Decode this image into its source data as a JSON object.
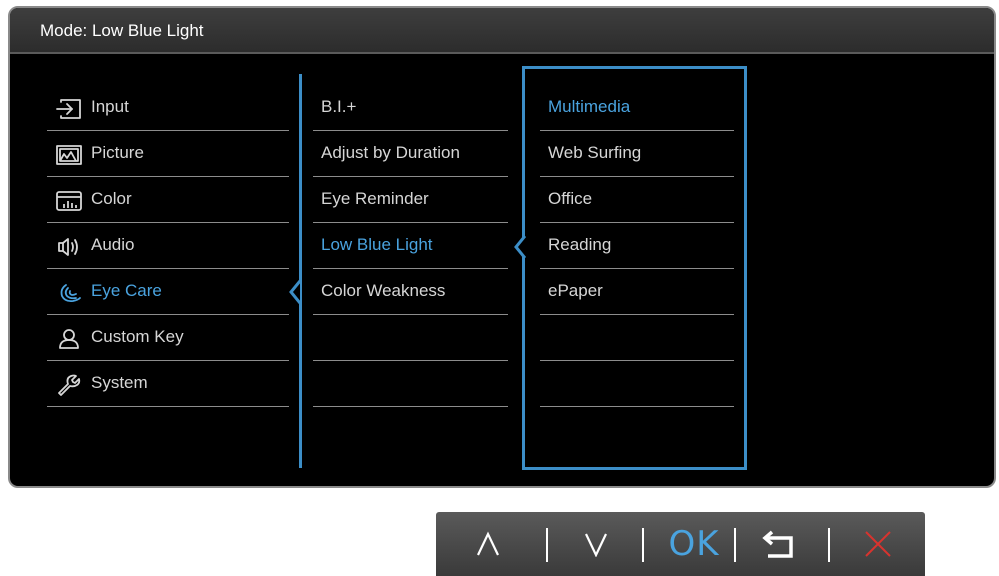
{
  "header": {
    "title": "Mode: Low Blue Light"
  },
  "menu": {
    "items": [
      {
        "label": "Input",
        "icon": "input-icon",
        "active": false
      },
      {
        "label": "Picture",
        "icon": "picture-icon",
        "active": false
      },
      {
        "label": "Color",
        "icon": "color-icon",
        "active": false
      },
      {
        "label": "Audio",
        "icon": "audio-icon",
        "active": false
      },
      {
        "label": "Eye Care",
        "icon": "eye-care-icon",
        "active": true
      },
      {
        "label": "Custom Key",
        "icon": "custom-key-icon",
        "active": false
      },
      {
        "label": "System",
        "icon": "system-icon",
        "active": false
      }
    ]
  },
  "submenu": {
    "items": [
      {
        "label": "B.I.+"
      },
      {
        "label": "Adjust by Duration"
      },
      {
        "label": "Eye Reminder"
      },
      {
        "label": "Low Blue Light",
        "active": true
      },
      {
        "label": "Color Weakness"
      },
      {
        "label": ""
      },
      {
        "label": ""
      }
    ]
  },
  "options": {
    "items": [
      {
        "label": "Multimedia",
        "active": true
      },
      {
        "label": "Web Surfing"
      },
      {
        "label": "Office"
      },
      {
        "label": "Reading"
      },
      {
        "label": "ePaper"
      },
      {
        "label": ""
      },
      {
        "label": ""
      }
    ]
  },
  "navbar": {
    "buttons": [
      {
        "name": "up-button",
        "icon": "chevron-up-icon"
      },
      {
        "name": "down-button",
        "icon": "chevron-down-icon"
      },
      {
        "name": "ok-button",
        "label": "OK"
      },
      {
        "name": "back-button",
        "icon": "back-arrow-icon"
      },
      {
        "name": "exit-button",
        "icon": "close-icon"
      }
    ]
  },
  "colors": {
    "accent": "#4aa3df",
    "close": "#d9332e",
    "text": "#d6d6d6",
    "background": "#000000"
  }
}
